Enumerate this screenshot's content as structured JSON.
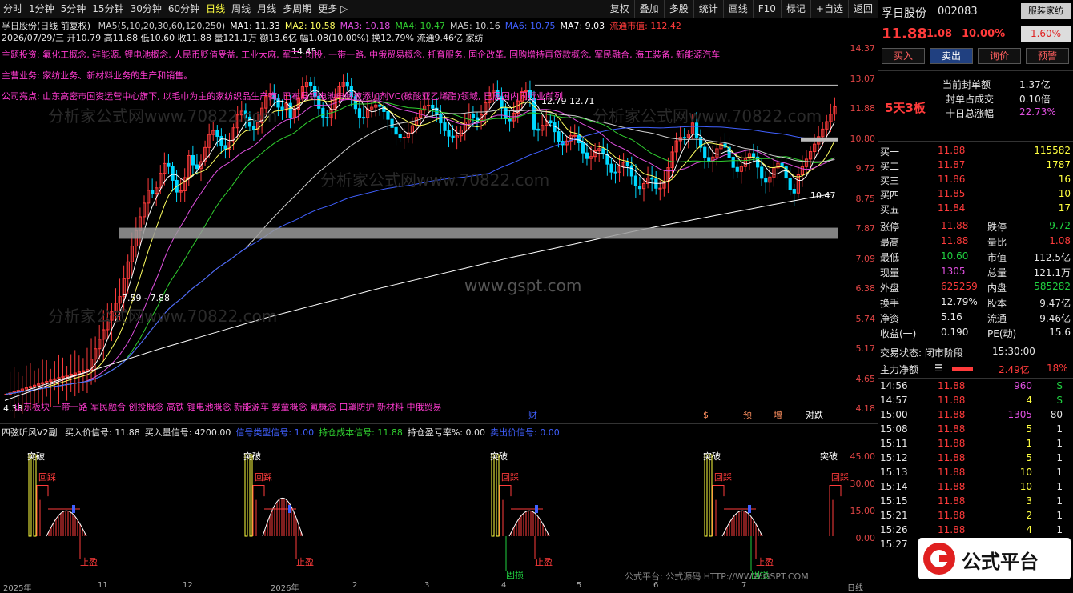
{
  "toolbar": {
    "left_items": [
      "分时",
      "1分钟",
      "5分钟",
      "15分钟",
      "30分钟",
      "60分钟",
      "日线",
      "周线",
      "月线",
      "多周期",
      "更多 ▷"
    ],
    "right_items": [
      "复权",
      "叠加",
      "多股",
      "统计",
      "画线",
      "F10",
      "标记",
      "+自选",
      "返回"
    ]
  },
  "chart": {
    "title": "孚日股份(日线 前复权)",
    "ma_labels": [
      {
        "text": "MA5(5,10,20,30,60,120,250)",
        "color": "#cccccc"
      },
      {
        "text": "MA1: 11.33",
        "color": "#ffffff"
      },
      {
        "text": "MA2: 10.58",
        "color": "#ffff60"
      },
      {
        "text": "MA3: 10.18",
        "color": "#e050e0"
      },
      {
        "text": "MA4: 10.47",
        "color": "#30d030"
      },
      {
        "text": "MA5: 10.16",
        "color": "#d0d0d0"
      },
      {
        "text": "MA6: 10.75",
        "color": "#4060ff"
      },
      {
        "text": "MA7: 9.03",
        "color": "#ffffff"
      },
      {
        "text": "流通市值: 112.42",
        "color": "#ff3b3b"
      }
    ],
    "day_info": "2026/07/29/三 开10.79 高11.88 低10.60 收11.88 量121.1万 额13.6亿 幅1.08(10.00%) 换12.79% 流通9.46亿 家纺",
    "theme_line": "主题投资: 氟化工概念, 硅能源, 锂电池概念, 人民币贬值受益, 工业大麻, 军工, 创投, 一带一路, 中俄贸易概念, 托育服务, 国企改革, 回购增持再贷款概念, 军民融合, 海工装备, 新能源汽车",
    "main_business": "主营业务: 家纺业务、新材料业务的生产和销售。",
    "highlight": "公司亮点: 山东高密市国资运营中心旗下, 以毛巾为主的家纺织品生产商, 已布局锂电池电解液添加剂VC(碳酸亚乙烯酯)领域, 已居国内同行业前列",
    "price_labels": [
      "14.37",
      "13.07",
      "11.88",
      "10.80",
      "9.72",
      "8.75",
      "7.87",
      "7.09",
      "6.38",
      "5.74",
      "5.17",
      "4.65",
      "4.18"
    ],
    "annotations": {
      "high": "14.45",
      "mid": "12.79 12.71",
      "band": "7.59 - 7.88",
      "low": "4.38",
      "right": "10.47",
      "ref_line": "11.88"
    },
    "concept_line": "山东板块 一带一路 军民融合 创投概念 高铁 锂电池概念 新能源车 婴童概念 氟概念 口罩防护 新材料 中俄贸易",
    "event_marks": [
      "财",
      "$",
      "预",
      "增",
      "对跌"
    ],
    "watermark1": "分析家公式网www.70822.com",
    "watermark2": "www.gspt.com"
  },
  "indicator": {
    "name": "四弦听风V2副",
    "items": [
      {
        "text": "买入价信号: 11.88",
        "color": "#e6e6e6"
      },
      {
        "text": "买入量信号: 4200.00",
        "color": "#e6e6e6"
      },
      {
        "text": "信号类型信号: 1.00",
        "color": "#4060ff"
      },
      {
        "text": "持仓成本信号: 11.88",
        "color": "#30d030"
      },
      {
        "text": "持仓盈亏率%: 0.00",
        "color": "#e6e6e6"
      },
      {
        "text": "卖出价信号: 0.00",
        "color": "#4060ff"
      }
    ],
    "scale": [
      "45.00",
      "30.00",
      "15.00",
      "0.00"
    ],
    "signal_texts": [
      "突破",
      "回踩",
      "止盈",
      "固损"
    ]
  },
  "xaxis": {
    "labels": [
      "2025年",
      "11",
      "12",
      "2026年",
      "2",
      "3",
      "4",
      "5",
      "6",
      "7"
    ],
    "right": "日线"
  },
  "stock": {
    "name": "孚日股份",
    "code": "002083",
    "industry_button": "服装家纺",
    "industry_change": "1.60%",
    "price": "11.88",
    "change": "1.08",
    "change_pct": "10.00%",
    "buttons": [
      "买入",
      "卖出",
      "询价",
      "预警"
    ],
    "seal_amount_label": "当前封单额",
    "seal_amount": "1.37亿",
    "seal_ratio_label": "封单占成交",
    "seal_ratio": "0.10倍",
    "ten_day_label": "十日总涨幅",
    "ten_day": "22.73%",
    "board_tag": "5天3板"
  },
  "orderbook": [
    {
      "label": "买一",
      "price": "11.88",
      "vol": "115582"
    },
    {
      "label": "买二",
      "price": "11.87",
      "vol": "1787"
    },
    {
      "label": "买三",
      "price": "11.86",
      "vol": "16"
    },
    {
      "label": "买四",
      "price": "11.85",
      "vol": "10"
    },
    {
      "label": "买五",
      "price": "11.84",
      "vol": "17"
    }
  ],
  "stats": [
    {
      "l1": "涨停",
      "v1": "11.88",
      "c1": "#ff3b3b",
      "l2": "跌停",
      "v2": "9.72",
      "c2": "#20d040"
    },
    {
      "l1": "最高",
      "v1": "11.88",
      "c1": "#ff3b3b",
      "l2": "量比",
      "v2": "1.08",
      "c2": "#ff3b3b"
    },
    {
      "l1": "最低",
      "v1": "10.60",
      "c1": "#20d040",
      "l2": "市值",
      "v2": "112.5亿",
      "c2": "#e6e6e6"
    },
    {
      "l1": "现量",
      "v1": "1305",
      "c1": "#e050e0",
      "l2": "总量",
      "v2": "121.1万",
      "c2": "#e6e6e6"
    },
    {
      "l1": "外盘",
      "v1": "625259",
      "c1": "#ff3b3b",
      "l2": "内盘",
      "v2": "585282",
      "c2": "#20d040"
    },
    {
      "l1": "换手",
      "v1": "12.79%",
      "c1": "#e6e6e6",
      "l2": "股本",
      "v2": "9.47亿",
      "c2": "#e6e6e6"
    },
    {
      "l1": "净资",
      "v1": "5.16",
      "c1": "#e6e6e6",
      "l2": "流通",
      "v2": "9.46亿",
      "c2": "#e6e6e6"
    },
    {
      "l1": "收益(一)",
      "v1": "0.190",
      "c1": "#e6e6e6",
      "l2": "PE(动)",
      "v2": "15.6",
      "c2": "#e6e6e6"
    }
  ],
  "trade_status": {
    "label": "交易状态: 闭市阶段",
    "time": "15:30:00"
  },
  "main_flow": {
    "label": "主力净额",
    "value": "2.49亿",
    "pct": "18%"
  },
  "ticks": [
    {
      "time": "14:56",
      "price": "11.88",
      "vol": "960",
      "side": "S",
      "vc": "#e050e0",
      "sc": "#20d040"
    },
    {
      "time": "14:57",
      "price": "11.88",
      "vol": "4",
      "side": "S",
      "vc": "#ffff40",
      "sc": "#20d040"
    },
    {
      "time": "15:00",
      "price": "11.88",
      "vol": "1305",
      "side": "80",
      "vc": "#e050e0",
      "sc": "#e6e6e6"
    },
    {
      "time": "15:08",
      "price": "11.88",
      "vol": "5",
      "side": "1",
      "vc": "#ffff40",
      "sc": "#e6e6e6"
    },
    {
      "time": "15:11",
      "price": "11.88",
      "vol": "1",
      "side": "1",
      "vc": "#ffff40",
      "sc": "#e6e6e6"
    },
    {
      "time": "15:12",
      "price": "11.88",
      "vol": "5",
      "side": "1",
      "vc": "#ffff40",
      "sc": "#e6e6e6"
    },
    {
      "time": "15:13",
      "price": "11.88",
      "vol": "10",
      "side": "1",
      "vc": "#ffff40",
      "sc": "#e6e6e6"
    },
    {
      "time": "15:14",
      "price": "11.88",
      "vol": "10",
      "side": "1",
      "vc": "#ffff40",
      "sc": "#e6e6e6"
    },
    {
      "time": "15:15",
      "price": "11.88",
      "vol": "3",
      "side": "1",
      "vc": "#ffff40",
      "sc": "#e6e6e6"
    },
    {
      "time": "15:21",
      "price": "11.88",
      "vol": "2",
      "side": "1",
      "vc": "#ffff40",
      "sc": "#e6e6e6"
    },
    {
      "time": "15:26",
      "price": "11.88",
      "vol": "4",
      "side": "1",
      "vc": "#ffff40",
      "sc": "#e6e6e6"
    },
    {
      "time": "15:27",
      "price": "",
      "vol": "",
      "side": "",
      "vc": "#ffff40",
      "sc": "#e6e6e6"
    }
  ],
  "logo": {
    "text": "公式平台",
    "url": "www.gspt.com"
  },
  "footer_credit": "公式平台: 公式源码 HTTP://WWW.GSPT.COM"
}
